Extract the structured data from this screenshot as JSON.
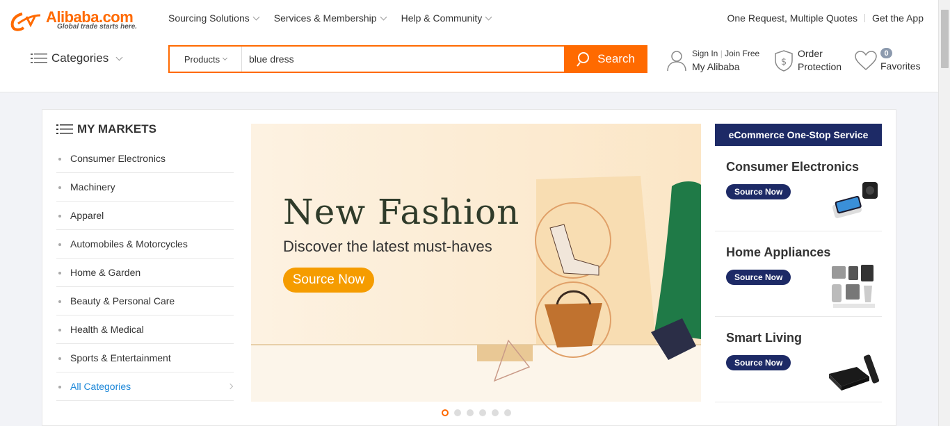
{
  "header": {
    "logo_text": "Alibaba.com",
    "logo_tagline": "Global trade starts here.",
    "nav": [
      "Sourcing Solutions",
      "Services & Membership",
      "Help & Community"
    ],
    "links": [
      "One Request, Multiple Quotes",
      "Get the App"
    ],
    "categories_label": "Categories",
    "search": {
      "category": "Products",
      "value": "blue dress",
      "button_label": "Search"
    },
    "account": {
      "sign_in": "Sign In",
      "join": "Join Free",
      "my": "My Alibaba"
    },
    "order": {
      "line1": "Order",
      "line2": "Protection"
    },
    "favorites": {
      "count": "0",
      "label": "Favorites"
    }
  },
  "markets": {
    "title": "MY MARKETS",
    "items": [
      "Consumer Electronics",
      "Machinery",
      "Apparel",
      "Automobiles & Motorcycles",
      "Home & Garden",
      "Beauty & Personal Care",
      "Health & Medical",
      "Sports & Entertainment",
      "All Categories"
    ]
  },
  "banner": {
    "title": "New Fashion",
    "subtitle": "Discover the latest must-haves",
    "button": "Source Now",
    "slides": 6,
    "active_slide": 1
  },
  "ecommerce": {
    "title": "eCommerce One-Stop Service",
    "items": [
      {
        "name": "Consumer Electronics",
        "button": "Source Now"
      },
      {
        "name": "Home Appliances",
        "button": "Source Now"
      },
      {
        "name": "Smart Living",
        "button": "Source Now"
      }
    ]
  },
  "colors": {
    "brand_orange": "#ff6a00",
    "navy": "#1d2a66",
    "link_blue": "#1a86d8"
  }
}
